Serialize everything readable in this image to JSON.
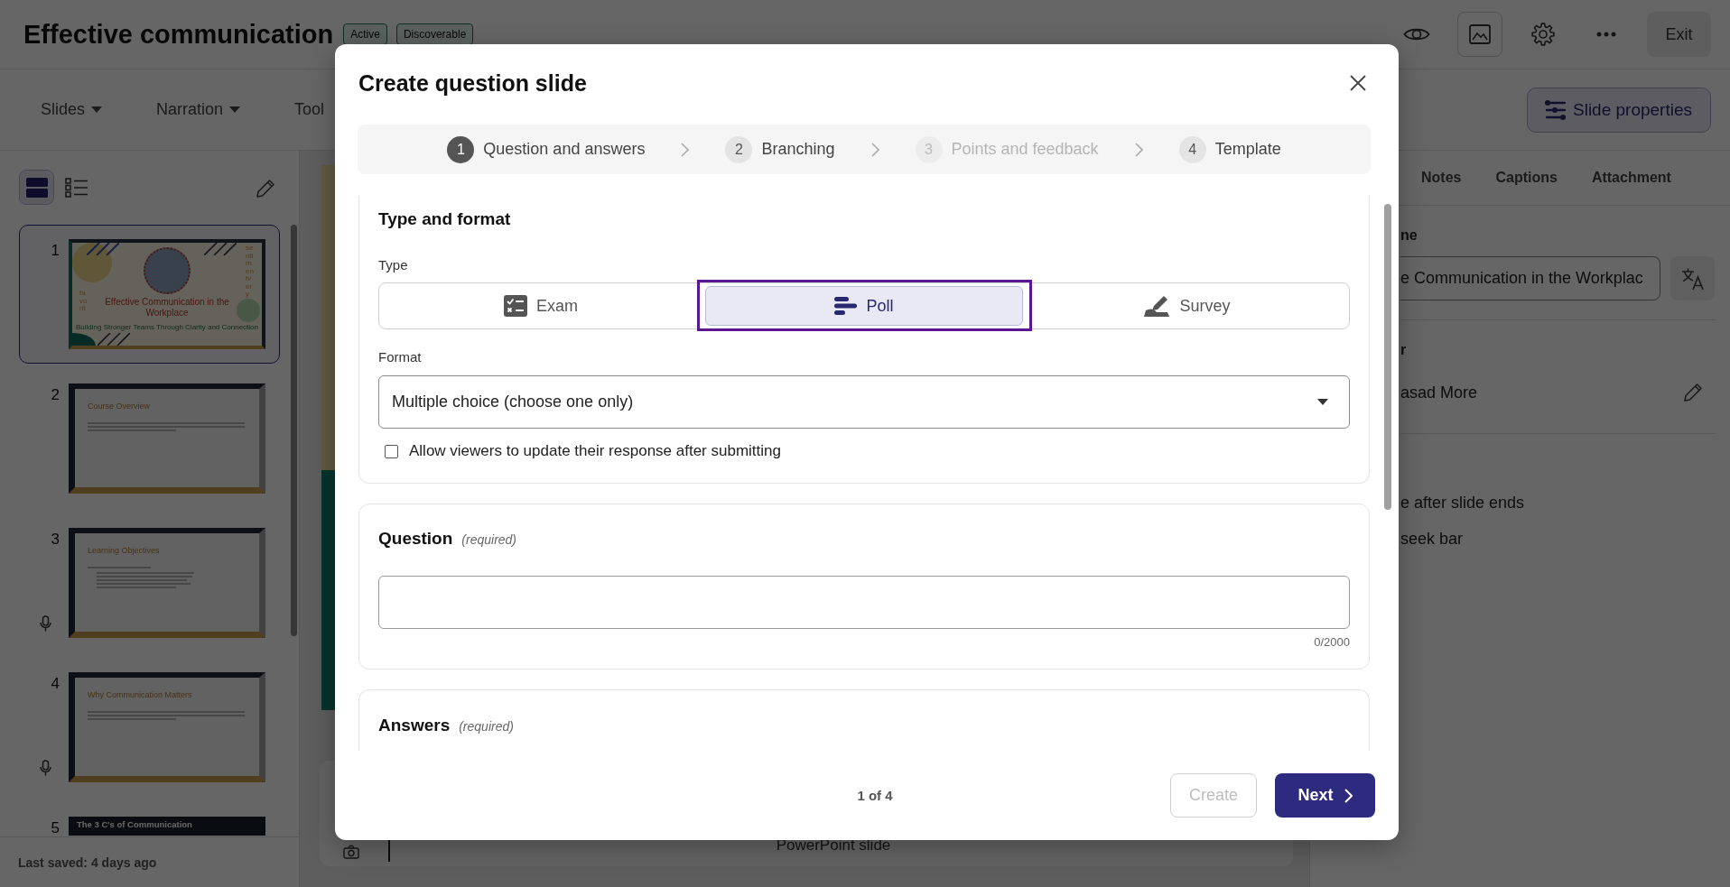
{
  "header": {
    "title": "Effective communication",
    "badges": [
      {
        "label": "Active"
      },
      {
        "label": "Discoverable"
      }
    ],
    "exit_button": "Exit"
  },
  "toolbar": {
    "menus": [
      {
        "label": "Slides",
        "caret": true
      },
      {
        "label": "Narration",
        "caret": true
      },
      {
        "label": "Tool",
        "caret": false
      }
    ],
    "slide_properties_button": "Slide properties"
  },
  "slide_panel": {
    "views": [
      {
        "kind": "grid",
        "selected": true
      },
      {
        "kind": "list",
        "selected": false
      }
    ],
    "slides": [
      {
        "number": "1",
        "kind": "title",
        "selected": true,
        "audio": false,
        "title": "Effective Communication in the Workplace",
        "subtitle": "Building Stronger Teams Through Clarity and Connection",
        "side_texts": [
          "favorit",
          "sentimentvery"
        ]
      },
      {
        "number": "2",
        "kind": "text",
        "selected": false,
        "audio": false,
        "title": "Course Overview"
      },
      {
        "number": "3",
        "kind": "bullets",
        "selected": false,
        "audio": true,
        "title": "Learning Objectives"
      },
      {
        "number": "4",
        "kind": "text",
        "selected": false,
        "audio": true,
        "title": "Why Communication Matters"
      },
      {
        "number": "5",
        "kind": "dark",
        "selected": false,
        "audio": false,
        "title": "The 3 C's of Communication"
      }
    ],
    "last_saved": "Last saved: 4 days ago"
  },
  "canvas": {
    "caption": "PowerPoint slide"
  },
  "properties_panel": {
    "tabs": [
      {
        "label": "Notes",
        "selected": false
      },
      {
        "label": "Captions",
        "selected": false
      },
      {
        "label": "Attachment",
        "selected": false
      }
    ],
    "fields": [
      {
        "kind": "input",
        "label": "ne",
        "value": "e Communication in the Workplac"
      },
      {
        "kind": "editable",
        "label": "r",
        "value": "asad More"
      }
    ],
    "options": [
      {
        "label": "e after slide ends"
      },
      {
        "label": "seek bar"
      }
    ]
  },
  "dialog": {
    "title": "Create question slide",
    "steps": [
      {
        "number": "1",
        "label": "Question and answers",
        "selected": true,
        "disabled": false
      },
      {
        "number": "2",
        "label": "Branching",
        "selected": false,
        "disabled": false
      },
      {
        "number": "3",
        "label": "Points and feedback",
        "selected": false,
        "disabled": true
      },
      {
        "number": "4",
        "label": "Template",
        "selected": false,
        "disabled": false
      }
    ],
    "type_and_format": {
      "heading": "Type and format",
      "type_label": "Type",
      "types": [
        {
          "kind": "exam",
          "label": "Exam",
          "selected": false,
          "focused": false
        },
        {
          "kind": "poll",
          "label": "Poll",
          "selected": true,
          "focused": true
        },
        {
          "kind": "survey",
          "label": "Survey",
          "selected": false,
          "focused": false
        }
      ],
      "format_label": "Format",
      "format_value": "Multiple choice (choose one only)",
      "update_option": {
        "label": "Allow viewers to update their response after submitting",
        "checked": false
      }
    },
    "question": {
      "heading": "Question",
      "note": "(required)",
      "counter": "0/2000"
    },
    "answers": {
      "heading": "Answers",
      "note": "(required)"
    },
    "page": "1 of 4",
    "buttons": [
      {
        "kind": "create",
        "label": "Create",
        "disabled": true
      },
      {
        "kind": "next",
        "label": "Next",
        "disabled": false
      }
    ]
  }
}
